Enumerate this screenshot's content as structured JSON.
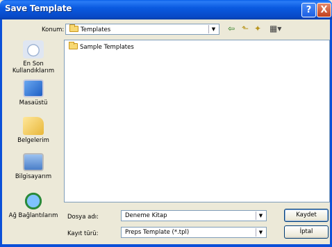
{
  "window": {
    "title": "Save Template"
  },
  "title_buttons": {
    "help": "?",
    "close": "X"
  },
  "look_in": {
    "label": "Konum:",
    "value": "Templates"
  },
  "toolbar": {
    "back_glyph": "⇦",
    "up_glyph": "⬑",
    "new_folder_glyph": "✦",
    "views_glyph": "▦▾"
  },
  "places": [
    {
      "label": "En Son Kullandıklarım",
      "icon": "recent-documents-icon"
    },
    {
      "label": "Masaüstü",
      "icon": "desktop-icon"
    },
    {
      "label": "Belgelerim",
      "icon": "my-documents-icon"
    },
    {
      "label": "Bilgisayarım",
      "icon": "my-computer-icon"
    },
    {
      "label": "Ağ Bağlantılarım",
      "icon": "network-places-icon"
    }
  ],
  "files": [
    {
      "name": "Sample Templates",
      "type": "folder"
    }
  ],
  "file_name": {
    "label": "Dosya adı:",
    "value": "Deneme Kitap"
  },
  "file_type": {
    "label": "Kayıt türü:",
    "value": "Preps Template (*.tpl)"
  },
  "buttons": {
    "save": "Kaydet",
    "cancel": "İptal"
  },
  "colors": {
    "titlebar": "#0a5ae0",
    "dialog_bg": "#ece9d8",
    "border": "#7f9db9"
  }
}
